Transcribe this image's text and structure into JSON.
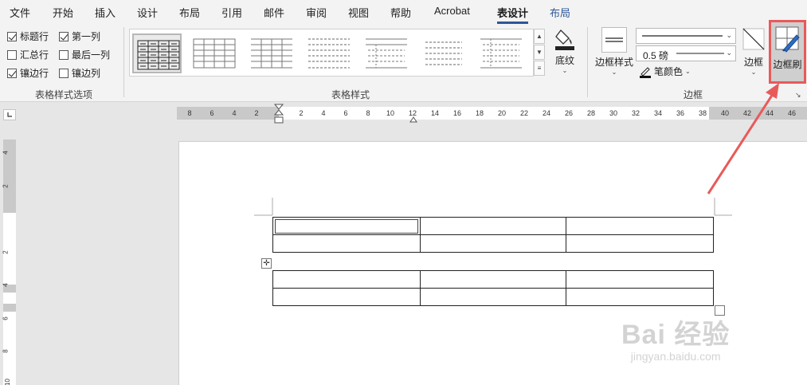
{
  "menu": {
    "tabs": [
      {
        "label": "文件"
      },
      {
        "label": "开始"
      },
      {
        "label": "插入"
      },
      {
        "label": "设计"
      },
      {
        "label": "布局"
      },
      {
        "label": "引用"
      },
      {
        "label": "邮件"
      },
      {
        "label": "审阅"
      },
      {
        "label": "视图"
      },
      {
        "label": "帮助"
      },
      {
        "label": "Acrobat"
      },
      {
        "label": "表设计"
      },
      {
        "label": "布局"
      }
    ]
  },
  "style_options": {
    "group_label": "表格样式选项",
    "items": [
      {
        "label": "标题行",
        "checked": true
      },
      {
        "label": "第一列",
        "checked": true
      },
      {
        "label": "汇总行",
        "checked": false
      },
      {
        "label": "最后一列",
        "checked": false
      },
      {
        "label": "镶边行",
        "checked": true
      },
      {
        "label": "镶边列",
        "checked": false
      }
    ]
  },
  "table_styles": {
    "group_label": "表格样式",
    "shading_label": "底纹"
  },
  "borders": {
    "group_label": "边框",
    "border_styles_label": "边框样式",
    "weight_value": "0.5 磅",
    "pen_color_label": "笔颜色",
    "borders_label": "边框",
    "border_painter_label": "边框刷"
  },
  "ruler": {
    "h_numbers": [
      "8",
      "6",
      "4",
      "2",
      "2",
      "4",
      "6",
      "8",
      "10",
      "12",
      "14",
      "16",
      "18",
      "20",
      "22",
      "24",
      "26",
      "28",
      "30",
      "32",
      "34",
      "36",
      "38",
      "40",
      "42",
      "44",
      "46"
    ],
    "v_numbers": [
      "4",
      "2",
      "2",
      "4",
      "6",
      "8",
      "10"
    ]
  },
  "watermark": {
    "main": "Bai 经验",
    "sub": "jingyan.baidu.com"
  },
  "colors": {
    "accent": "#2b579a",
    "highlight": "#e85a5a"
  }
}
